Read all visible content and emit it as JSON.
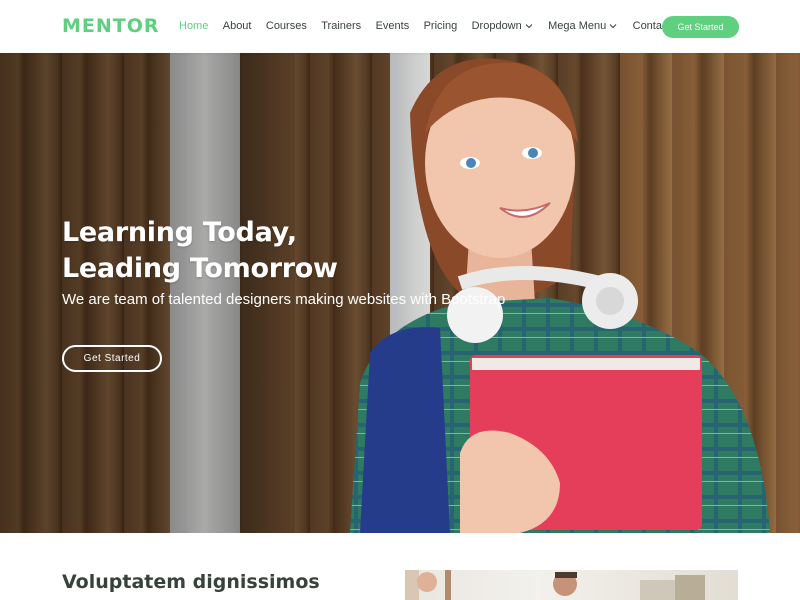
{
  "brand": {
    "logo": "MENTOR",
    "accent": "#5fcf80",
    "text_color": "#37423b"
  },
  "nav": {
    "items": [
      {
        "label": "Home",
        "active": true
      },
      {
        "label": "About"
      },
      {
        "label": "Courses"
      },
      {
        "label": "Trainers"
      },
      {
        "label": "Events"
      },
      {
        "label": "Pricing"
      },
      {
        "label": "Dropdown",
        "icon": "chevron-down-icon"
      },
      {
        "label": "Mega Menu",
        "icon": "chevron-down-icon"
      },
      {
        "label": "Contact"
      }
    ],
    "cta": "Get Started"
  },
  "hero": {
    "title_line1": "Learning Today,",
    "title_line2": "Leading Tomorrow",
    "subtitle": "We are team of talented designers making websites with Bootstrap",
    "button": "Get Started"
  },
  "about": {
    "title": "Voluptatem dignissimos provident quasi corporis"
  }
}
